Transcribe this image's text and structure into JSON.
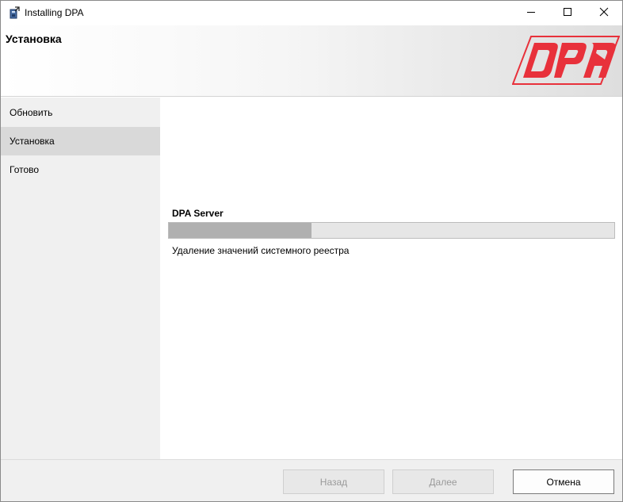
{
  "window": {
    "title": "Installing DPA"
  },
  "header": {
    "title": "Установка",
    "logo_text": "DPA",
    "logo_color": "#e8313b"
  },
  "sidebar": {
    "items": [
      {
        "label": "Обновить",
        "active": false
      },
      {
        "label": "Установка",
        "active": true
      },
      {
        "label": "Готово",
        "active": false
      }
    ]
  },
  "main": {
    "component_label": "DPA Server",
    "progress_fraction": 0.32,
    "status_text": "Удаление значений системного реестра"
  },
  "footer": {
    "back_label": "Назад",
    "next_label": "Далее",
    "cancel_label": "Отмена"
  },
  "icons": {
    "app": "installer-icon",
    "minimize": "minimize-icon",
    "maximize": "maximize-icon",
    "close": "close-icon"
  }
}
